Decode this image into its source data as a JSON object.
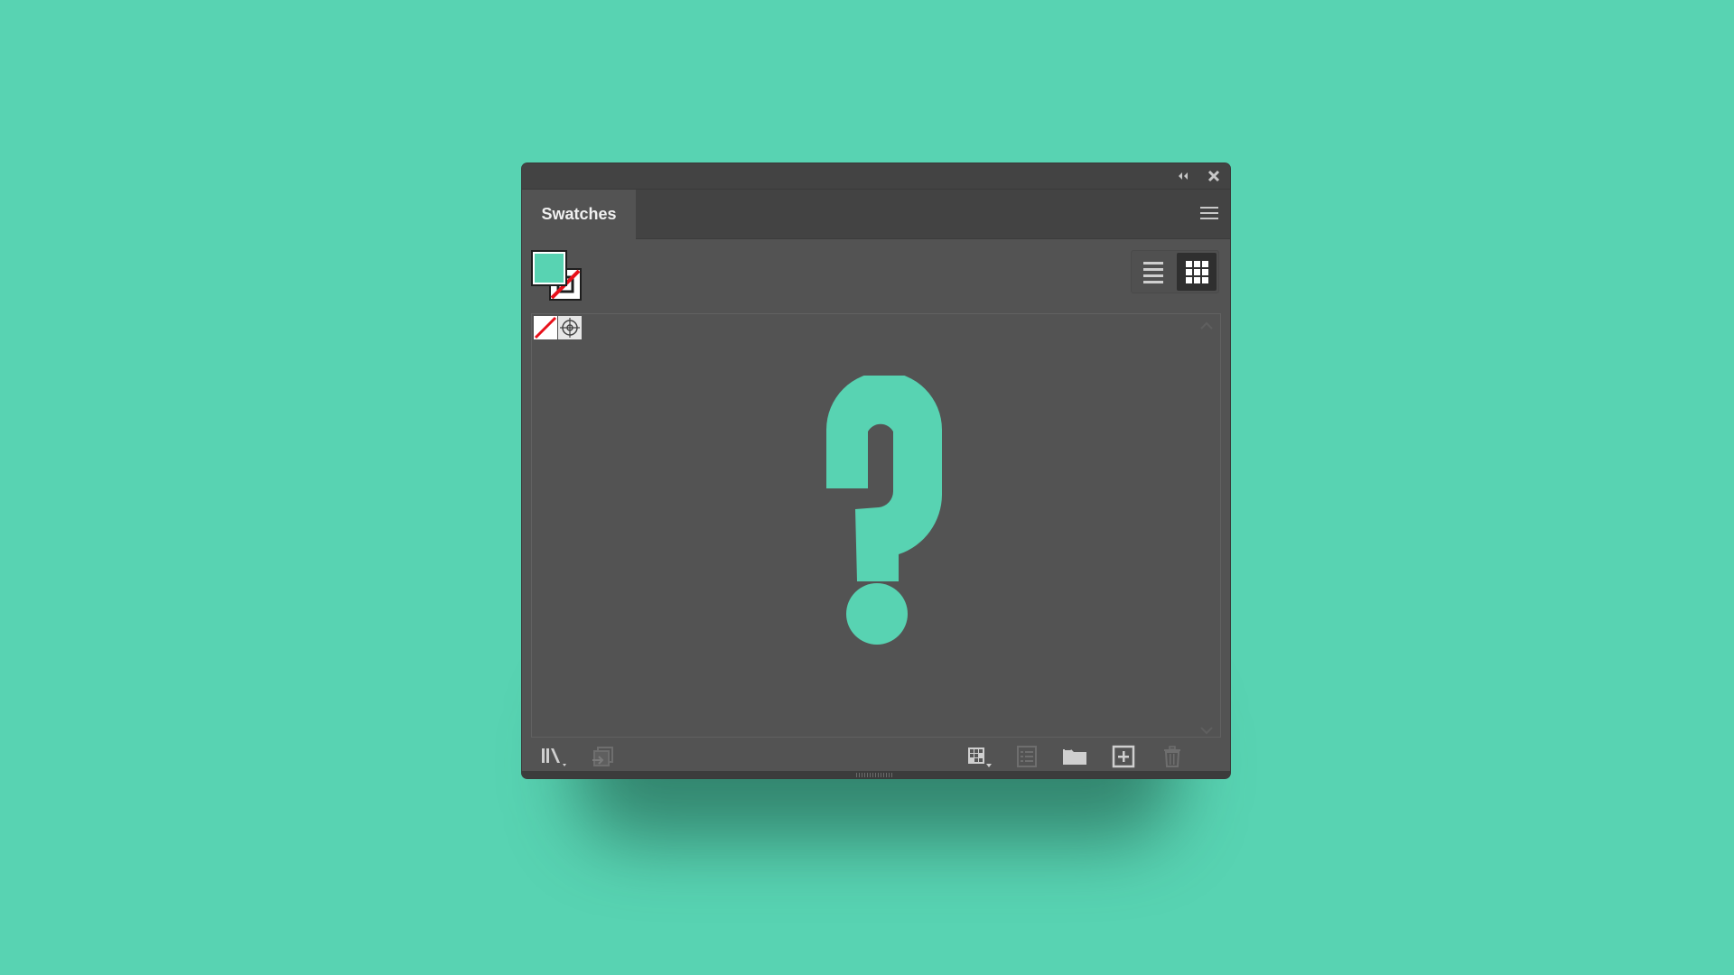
{
  "panel": {
    "title": "Swatches",
    "colors": {
      "background": "#58d3b2",
      "panel_bg": "#535353",
      "titlebar_bg": "#434343",
      "fill_color": "#58d3b2",
      "none_red": "#e8101a"
    }
  },
  "titlebar": {
    "collapse_icon": "double-chevron-left-icon",
    "close_icon": "close-icon"
  },
  "tabs": [
    {
      "label": "Swatches",
      "active": true
    }
  ],
  "menu_icon": "hamburger-menu-icon",
  "fill_stroke": {
    "fill": "#58d3b2",
    "stroke": "none"
  },
  "view_toggle": {
    "list_view": "list-view-icon",
    "grid_view": "grid-view-icon",
    "selected": "grid"
  },
  "swatches": [
    {
      "name": "[None]",
      "icon": "none-swatch-icon"
    },
    {
      "name": "[Registration]",
      "icon": "registration-swatch-icon"
    }
  ],
  "placeholder_icon": "question-mark-icon",
  "footer": {
    "left": [
      {
        "name": "swatch-libraries-menu",
        "icon": "library-icon",
        "enabled": true
      },
      {
        "name": "place-swatches",
        "icon": "place-swatch-icon",
        "enabled": false
      }
    ],
    "right": [
      {
        "name": "show-swatch-kinds-menu",
        "icon": "swatch-kinds-icon",
        "enabled": true
      },
      {
        "name": "swatch-options",
        "icon": "swatch-options-icon",
        "enabled": false
      },
      {
        "name": "new-color-group",
        "icon": "folder-icon",
        "enabled": true
      },
      {
        "name": "new-swatch",
        "icon": "new-swatch-icon",
        "enabled": true
      },
      {
        "name": "delete-swatch",
        "icon": "trash-icon",
        "enabled": false
      }
    ]
  }
}
